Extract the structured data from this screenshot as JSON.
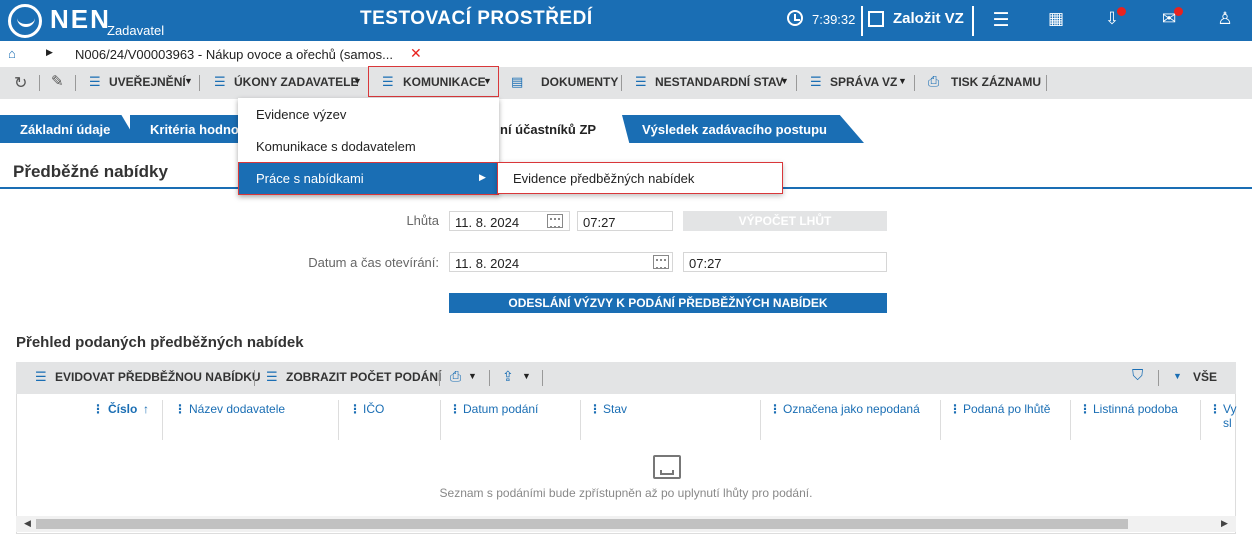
{
  "header": {
    "logo": "NEN",
    "logo_sub": "Zadavatel",
    "environment": "TESTOVACÍ PROSTŘEDÍ",
    "time": "7:39:32",
    "create_label": "Založit VZ",
    "icons": [
      "menu-icon",
      "calculator-icon",
      "inbox-icon",
      "mail-icon",
      "user-icon"
    ],
    "notification_color": "#e8231f",
    "brand_color": "#1a6eb4"
  },
  "breadcrumb": {
    "title": "N006/24/V00003963 - Nákup ovoce a ořechů (samos..."
  },
  "toolbar": {
    "items": [
      {
        "label": "UVEŘEJNĚNÍ"
      },
      {
        "label": "ÚKONY ZADAVATELE"
      },
      {
        "label": "KOMUNIKACE"
      },
      {
        "label": "DOKUMENTY"
      },
      {
        "label": "NESTANDARDNÍ STAV"
      },
      {
        "label": "SPRÁVA VZ"
      },
      {
        "label": "TISK ZÁZNAMU"
      }
    ]
  },
  "tabs": [
    {
      "label": "Základní údaje"
    },
    {
      "label": "Kritéria hodno"
    },
    {
      "label": "ní účastníků ZP"
    },
    {
      "label": "Výsledek zadávacího postupu"
    }
  ],
  "dropdown": {
    "items": [
      {
        "label": "Evidence výzev"
      },
      {
        "label": "Komunikace s dodavatelem"
      },
      {
        "label": "Práce s nabídkami"
      }
    ],
    "submenu": {
      "label": "Evidence předběžných nabídek"
    }
  },
  "section": {
    "title": "Předběžné nabídky"
  },
  "form": {
    "deadline_label": "Lhůta",
    "deadline_date": "11. 8. 2024",
    "deadline_time": "07:27",
    "calc_button": "VÝPOČET LHŮT",
    "opening_label": "Datum a čas otevírání:",
    "opening_date": "11. 8. 2024",
    "opening_time": "07:27",
    "send_button": "ODESLÁNÍ VÝZVY K PODÁNÍ PŘEDBĚŽNÝCH NABÍDEK"
  },
  "grid": {
    "title": "Přehled podaných předběžných nabídek",
    "toolbar_record": "EVIDOVAT PŘEDBĚŽNOU NABÍDKU",
    "toolbar_count": "ZOBRAZIT POČET PODÁNÍ",
    "toolbar_all": "VŠE",
    "columns": [
      "Číslo",
      "Název dodavatele",
      "IČO",
      "Datum podání",
      "Stav",
      "Označena jako nepodaná",
      "Podaná po lhůtě",
      "Listinná podoba",
      "Vy",
      "sl"
    ],
    "empty_message": "Seznam s podáními bude zpřístupněn až po uplynutí lhůty pro podání."
  }
}
